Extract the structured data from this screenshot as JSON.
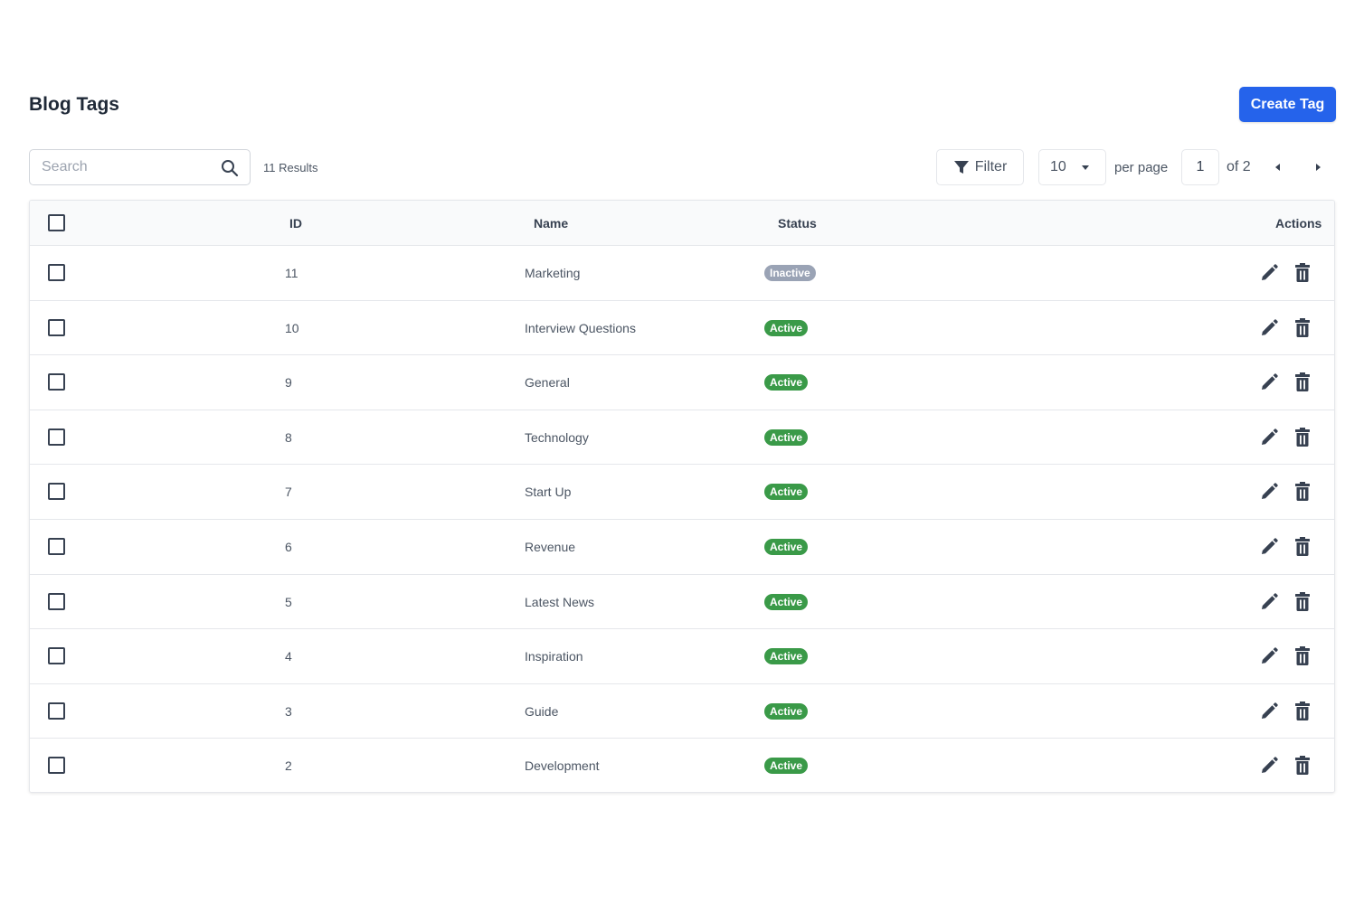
{
  "header": {
    "title": "Blog Tags",
    "create_button_label": "Create Tag"
  },
  "toolbar": {
    "search_placeholder": "Search",
    "results_text": "11 Results",
    "filter_label": "Filter",
    "per_page_value": "10",
    "per_page_label": "per page",
    "current_page": "1",
    "page_of_text": "of 2"
  },
  "table": {
    "columns": {
      "id": "ID",
      "name": "Name",
      "status": "Status",
      "actions": "Actions"
    },
    "rows": [
      {
        "id": "11",
        "name": "Marketing",
        "status": "Inactive"
      },
      {
        "id": "10",
        "name": "Interview Questions",
        "status": "Active"
      },
      {
        "id": "9",
        "name": "General",
        "status": "Active"
      },
      {
        "id": "8",
        "name": "Technology",
        "status": "Active"
      },
      {
        "id": "7",
        "name": "Start Up",
        "status": "Active"
      },
      {
        "id": "6",
        "name": "Revenue",
        "status": "Active"
      },
      {
        "id": "5",
        "name": "Latest News",
        "status": "Active"
      },
      {
        "id": "4",
        "name": "Inspiration",
        "status": "Active"
      },
      {
        "id": "3",
        "name": "Guide",
        "status": "Active"
      },
      {
        "id": "2",
        "name": "Development",
        "status": "Active"
      }
    ]
  },
  "icons": {
    "search": "search-icon",
    "filter": "filter-icon",
    "caret": "caret-down-icon",
    "prev": "chevron-left-icon",
    "next": "chevron-right-icon",
    "edit": "pencil-icon",
    "delete": "trash-icon"
  },
  "colors": {
    "primary": "#2563eb",
    "active_badge": "#3a9a48",
    "inactive_badge": "#9aa3b5",
    "icon": "#374151"
  }
}
